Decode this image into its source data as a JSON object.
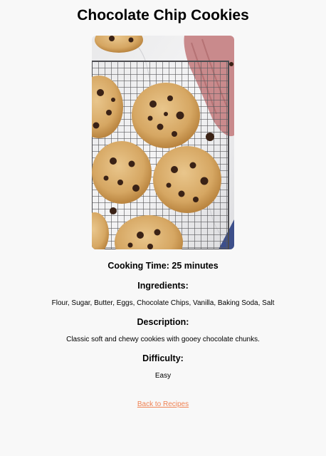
{
  "recipe": {
    "title": "Chocolate Chip Cookies",
    "cooking_time": "Cooking Time: 25 minutes",
    "ingredients_heading": "Ingredients:",
    "ingredients": "Flour, Sugar, Butter, Eggs, Chocolate Chips, Vanilla, Baking Soda, Salt",
    "description_heading": "Description:",
    "description": "Classic soft and chewy cookies with gooey chocolate chunks.",
    "difficulty_heading": "Difficulty:",
    "difficulty": "Easy"
  },
  "nav": {
    "back_label": "Back to Recipes"
  },
  "colors": {
    "background": "#f8f8f8",
    "link": "#ef8354"
  }
}
